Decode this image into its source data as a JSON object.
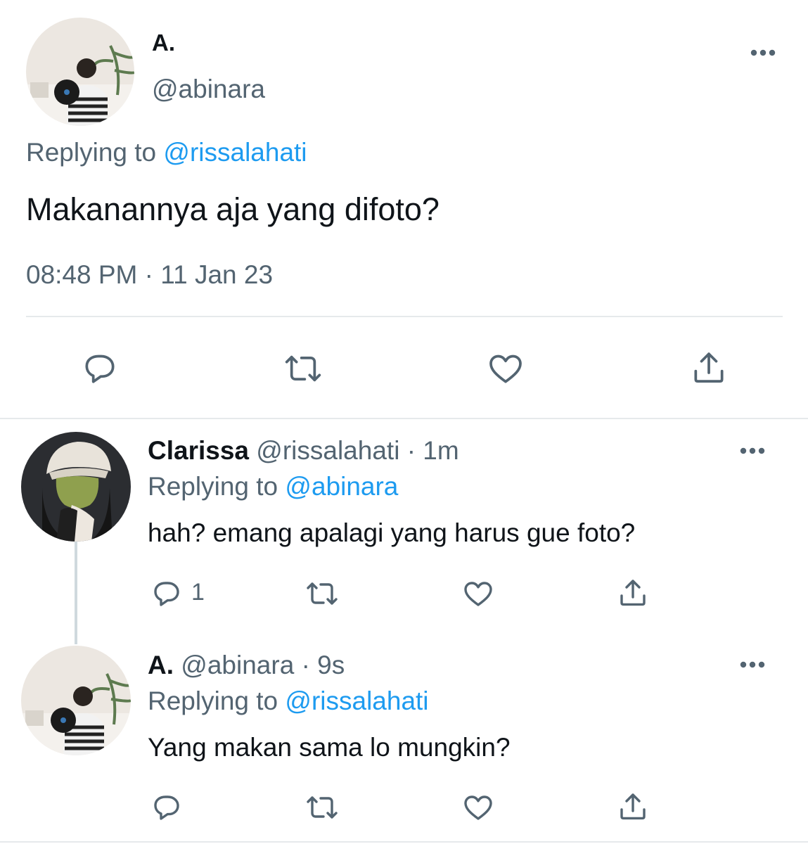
{
  "main_tweet": {
    "author_name": "A.",
    "handle": "@abinara",
    "replying_prefix": "Replying to",
    "replying_to": "@rissalahati",
    "text": "Makanannya aja yang difoto?",
    "timestamp": "08:48 PM · 11 Jan 23",
    "actions": {
      "reply_icon": "reply-icon",
      "retweet_icon": "retweet-icon",
      "like_icon": "heart-icon",
      "share_icon": "share-icon"
    }
  },
  "replies": [
    {
      "author_name": "Clarissa",
      "handle": "@rissalahati",
      "time": "· 1m",
      "replying_prefix": "Replying to",
      "replying_to": "@abinara",
      "text": "hah? emang apalagi yang harus gue foto?",
      "reply_count": "1"
    },
    {
      "author_name": "A.",
      "handle": "@abinara",
      "time": "· 9s",
      "replying_prefix": "Replying to",
      "replying_to": "@rissalahati",
      "text": "Yang makan sama lo mungkin?",
      "reply_count": ""
    }
  ],
  "colors": {
    "text": "#0f1419",
    "muted": "#536471",
    "link": "#1d9bf0",
    "divider": "#e6e9eb"
  }
}
